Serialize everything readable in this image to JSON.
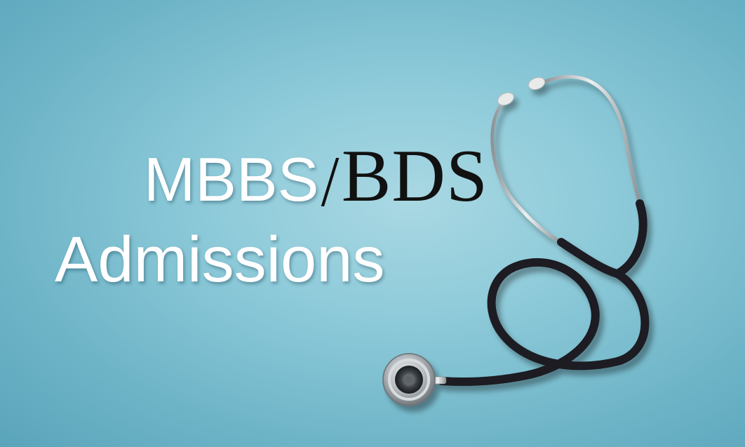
{
  "headline": {
    "line1_part1": "MBBS",
    "line1_separator": "/",
    "line1_part2": "BDS",
    "line2": "Admissions"
  },
  "colors": {
    "background_center": "#a9d8e3",
    "background_edge": "#5aa4ba",
    "white_text": "#ffffff",
    "dark_text": "#111111",
    "tubing": "#1b1e20",
    "metal": "#c9cdd0"
  },
  "image": {
    "subject": "stethoscope-icon"
  }
}
